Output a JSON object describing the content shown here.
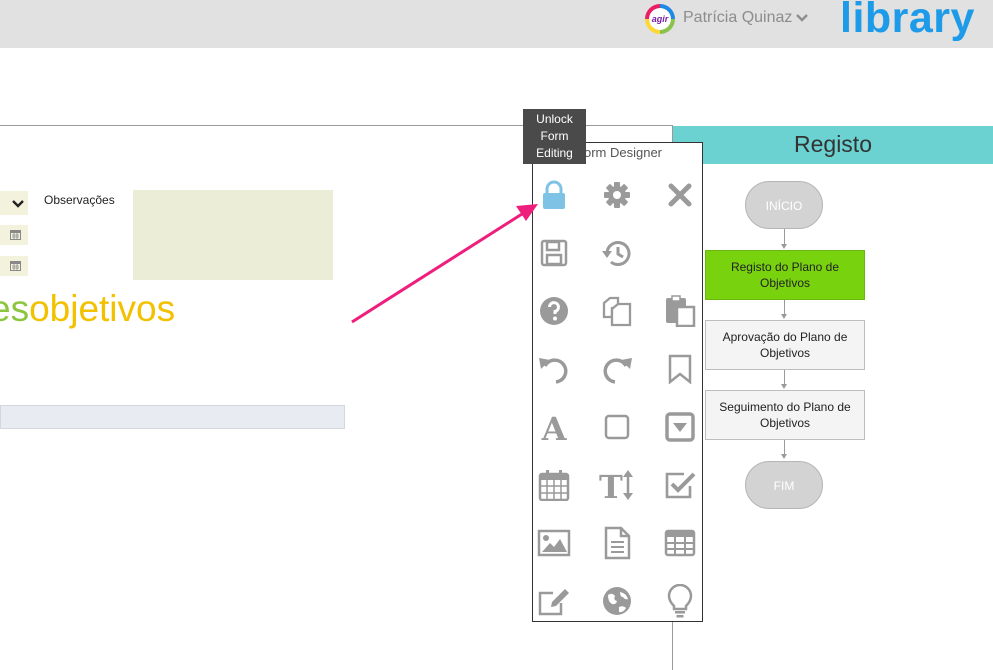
{
  "header": {
    "avatar_text": "agir",
    "user_name": "Patrícia Quinaz",
    "brand": "library"
  },
  "form": {
    "observacoes_label": "Observações",
    "title_part1": "es",
    "title_part2": "objetivos"
  },
  "designer": {
    "title": "Form Designer",
    "tooltip": [
      "Unlock",
      "Form",
      "Editing"
    ],
    "tools": [
      {
        "icon": "lock-icon",
        "label": "Unlock Form Editing",
        "active": true
      },
      {
        "icon": "gear-icon"
      },
      {
        "icon": "close-icon"
      },
      {
        "icon": "save-icon"
      },
      {
        "icon": "history-icon"
      },
      {
        "icon": "help-icon"
      },
      {
        "icon": "copy-icon"
      },
      {
        "icon": "paste-icon"
      },
      {
        "icon": "undo-icon"
      },
      {
        "icon": "redo-icon"
      },
      {
        "icon": "bookmark-icon"
      },
      {
        "icon": "text-icon"
      },
      {
        "icon": "box-icon"
      },
      {
        "icon": "dropdown-icon"
      },
      {
        "icon": "calendar-icon"
      },
      {
        "icon": "text-height-icon"
      },
      {
        "icon": "checkbox-icon"
      },
      {
        "icon": "image-icon"
      },
      {
        "icon": "document-icon"
      },
      {
        "icon": "table-icon"
      },
      {
        "icon": "edit-icon"
      },
      {
        "icon": "globe-icon"
      },
      {
        "icon": "lightbulb-icon"
      }
    ]
  },
  "workflow": {
    "title": "Registo",
    "start": "INÍCIO",
    "steps": [
      "Registo do Plano de Objetivos",
      "Aprovação do Plano de Objetivos",
      "Seguimento do Plano de Objetivos"
    ],
    "end": "FIM"
  },
  "colors": {
    "accent": "#6cd1d1",
    "active_step": "#79d20e",
    "brand": "#1e9be8",
    "annotation_arrow": "#ee1e7c",
    "lock_icon": "#7ec3e6",
    "tool_icon": "#9a9a9a"
  }
}
